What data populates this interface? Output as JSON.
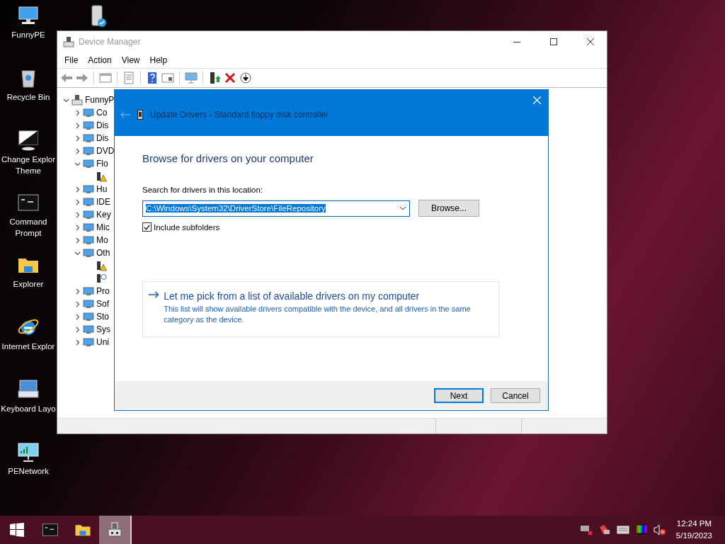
{
  "desktop_icons": [
    {
      "kind": "monitor",
      "label": "FunnyPE"
    },
    {
      "kind": "recycle",
      "label": "Recycle Bin"
    },
    {
      "kind": "theme",
      "label": "Change Explor Theme"
    },
    {
      "kind": "terminal",
      "label": "Command Prompt"
    },
    {
      "kind": "folder",
      "label": "Explorer"
    },
    {
      "kind": "browser",
      "label": "Internet Explor"
    },
    {
      "kind": "keyboard",
      "label": "Keyboard Layo"
    },
    {
      "kind": "network",
      "label": "PENetwork"
    }
  ],
  "device_manager": {
    "title": "Device Manager",
    "menu": [
      "File",
      "Action",
      "View",
      "Help"
    ],
    "tree": {
      "label": "FunnyP",
      "expanded": true,
      "children": [
        {
          "label": "Co",
          "expanded": false
        },
        {
          "label": "Dis",
          "expanded": false
        },
        {
          "label": "Dis",
          "expanded": false
        },
        {
          "label": "DVD",
          "expanded": false
        },
        {
          "label": "Flo",
          "expanded": true,
          "children": [
            {
              "warning": true
            }
          ]
        },
        {
          "label": "Hu",
          "expanded": false
        },
        {
          "label": "IDE",
          "expanded": false
        },
        {
          "label": "Key",
          "expanded": false
        },
        {
          "label": "Mic",
          "expanded": false
        },
        {
          "label": "Mo",
          "expanded": false
        },
        {
          "label": "Oth",
          "expanded": true,
          "children": [
            {
              "warning": true
            },
            {
              "warning": false
            }
          ]
        },
        {
          "label": "Pro",
          "expanded": false
        },
        {
          "label": "Sof",
          "expanded": false
        },
        {
          "label": "Sto",
          "expanded": false
        },
        {
          "label": "Sys",
          "expanded": false
        },
        {
          "label": "Uni",
          "expanded": false
        }
      ]
    }
  },
  "dialog": {
    "title": "Update Drivers - Standard floppy disk controller",
    "heading": "Browse for drivers on your computer",
    "location_label": "Search for drivers in this location:",
    "location_value": "C:\\Windows\\System32\\DriverStore\\FileRepository",
    "browse_button": "Browse...",
    "include_subfolders": {
      "label": "Include subfolders",
      "checked": true
    },
    "pick_option": {
      "title": "Let me pick from a list of available drivers on my computer",
      "description": "This list will show available drivers compatible with the device, and all drivers in the same category as the device."
    },
    "buttons": [
      {
        "label": "Next",
        "default": true
      },
      {
        "label": "Cancel",
        "default": false
      }
    ]
  },
  "taskbar": {
    "apps": [
      {
        "kind": "terminal",
        "selected": false
      },
      {
        "kind": "folder",
        "selected": false
      },
      {
        "kind": "device-manager",
        "selected": true
      }
    ],
    "time": "12:24 PM",
    "date": "5/19/2023"
  }
}
